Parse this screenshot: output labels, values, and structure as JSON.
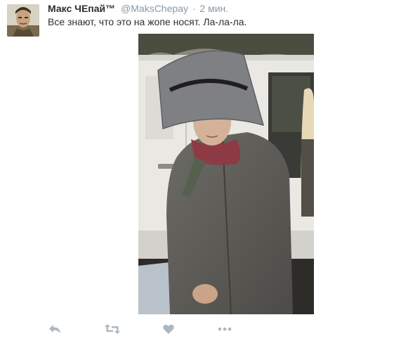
{
  "tweet": {
    "fullname": "Макс ЧЕпай™",
    "username": "@MaksChepay",
    "separator": "·",
    "timestamp": "2 мин.",
    "text": "Все знают, что это на жопе носят. Ла-ла-ла."
  },
  "media": {
    "plate_text_line1": "",
    "plate_text_line2": ""
  },
  "actions": {
    "icons": [
      "reply-icon",
      "retweet-icon",
      "like-icon",
      "more-icon"
    ]
  },
  "colors": {
    "text": "#292f33",
    "muted": "#8899a6",
    "icon": "#aab8c2"
  }
}
